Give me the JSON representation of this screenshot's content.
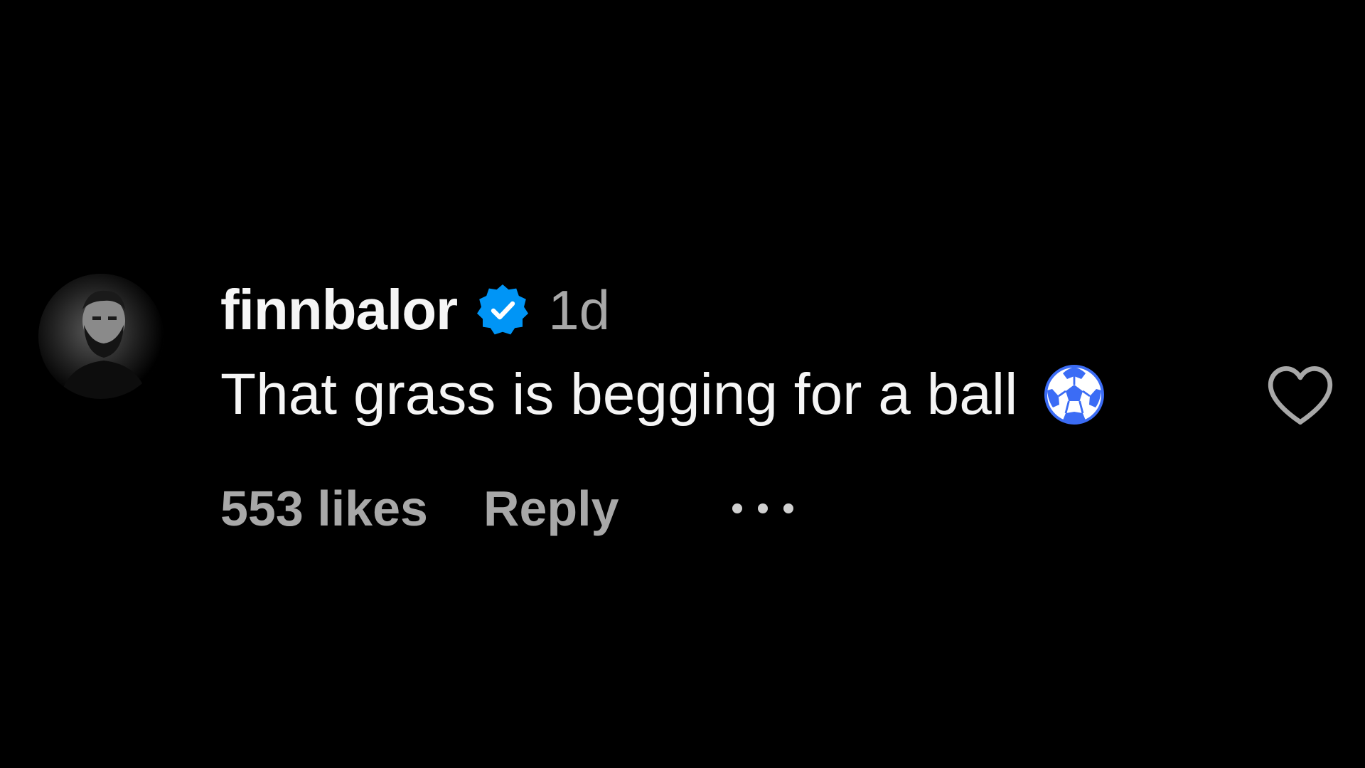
{
  "comment": {
    "username": "finnbalor",
    "timestamp": "1d",
    "text": "That grass is begging for a ball",
    "emoji": "soccer-ball-icon",
    "likes_label": "553 likes",
    "reply_label": "Reply",
    "more_icon": "more-options-icon",
    "like_icon": "heart-outline-icon",
    "verified_icon": "verified-badge-icon"
  },
  "colors": {
    "background": "#000000",
    "primary_text": "#f5f5f5",
    "secondary_text": "#a8a8a8",
    "verified_blue": "#0095f6",
    "emoji_blue": "#3b6cf5"
  }
}
